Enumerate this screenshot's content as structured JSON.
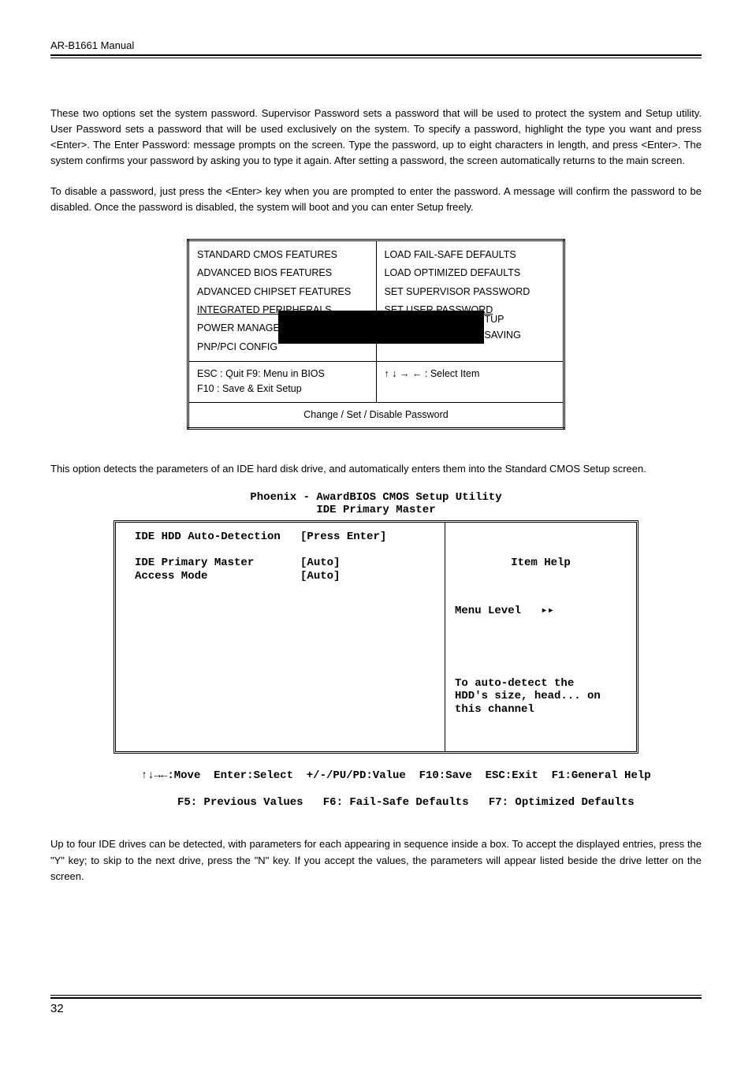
{
  "header": {
    "title": "AR-B1661 Manual"
  },
  "paragraphs": {
    "p1": "These two options set the system password. Supervisor Password sets a password that will be used to protect the system and Setup utility. User Password sets a password that will be used exclusively on the system. To specify a password, highlight the type you want and press <Enter>. The Enter Password: message prompts on the screen. Type the password, up to eight characters in length, and press <Enter>. The system confirms your password by asking you to type it again. After setting a password, the screen automatically returns to the main screen.",
    "p2": "To disable a password, just press the <Enter> key when you are prompted to enter the password. A message will confirm the password to be disabled. Once the password is disabled, the system will boot and you can enter Setup freely.",
    "p3": "This option detects the parameters of an IDE hard disk drive, and automatically enters them into the Standard CMOS Setup screen.",
    "p4": "Up to four IDE drives can be detected, with parameters for each appearing in sequence inside a box. To accept the displayed entries, press the \"Y\" key; to skip to the next drive, press the \"N\" key. If you accept the values, the parameters will appear listed beside the drive letter on the screen."
  },
  "bios_menu": {
    "left": [
      "STANDARD CMOS FEATURES",
      "ADVANCED BIOS FEATURES",
      "ADVANCED CHIPSET FEATURES",
      "INTEGRATED PERIPHERALS"
    ],
    "right": [
      "LOAD FAIL-SAFE DEFAULTS",
      "LOAD OPTIMIZED DEFAULTS",
      "SET SUPERVISOR PASSWORD",
      "SET USER PASSWORD"
    ],
    "left_partial_1_prefix": "POWER MANAGE",
    "left_partial_2_prefix": "PNP/PCI CONFIG",
    "right_partial_1_suffix": "TUP",
    "right_partial_2_suffix": "SAVING",
    "keys_left": "ESC : Quit       F9: Menu in BIOS",
    "keys_left2": "F10 : Save & Exit Setup",
    "keys_right": "↑ ↓ → ← : Select Item",
    "footer": "Change / Set / Disable Password"
  },
  "award": {
    "title_line1": "Phoenix - AwardBIOS CMOS Setup Utility",
    "title_line2": "IDE Primary Master",
    "left_lines": "IDE HDD Auto-Detection   [Press Enter]\n\nIDE Primary Master       [Auto]\nAccess Mode              [Auto]",
    "right_title": "Item Help",
    "right_line1": "Menu Level   ▸▸",
    "right_body": "To auto-detect the\nHDD's size, head... on\nthis channel",
    "footer_line1": "↑↓→←:Move  Enter:Select  +/-/PU/PD:Value  F10:Save  ESC:Exit  F1:General Help",
    "footer_line2": "   F5: Previous Values   F6: Fail-Safe Defaults   F7: Optimized Defaults"
  },
  "page_number": "32"
}
